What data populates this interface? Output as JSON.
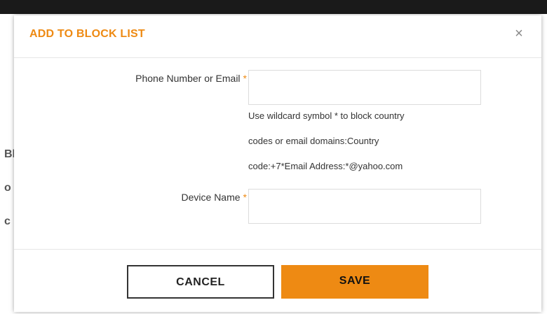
{
  "colors": {
    "accent": "#ee8a13",
    "required": "#ee8a13"
  },
  "dialog": {
    "title": "ADD TO BLOCK LIST",
    "close_icon": "close-icon",
    "close_glyph": "×"
  },
  "form": {
    "phone_email": {
      "label": "Phone Number or Email",
      "required_mark": "*",
      "value": "",
      "placeholder": ""
    },
    "help_lines": [
      "Use wildcard symbol * to block country",
      "codes or email domains:Country",
      "code:+7*Email Address:*@yahoo.com"
    ],
    "device_name": {
      "label": "Device Name",
      "required_mark": "*",
      "value": "",
      "placeholder": ""
    }
  },
  "footer": {
    "cancel_label": "CANCEL",
    "save_label": "SAVE"
  },
  "background": {
    "glyphs": [
      "Bl",
      "o",
      "c"
    ]
  }
}
